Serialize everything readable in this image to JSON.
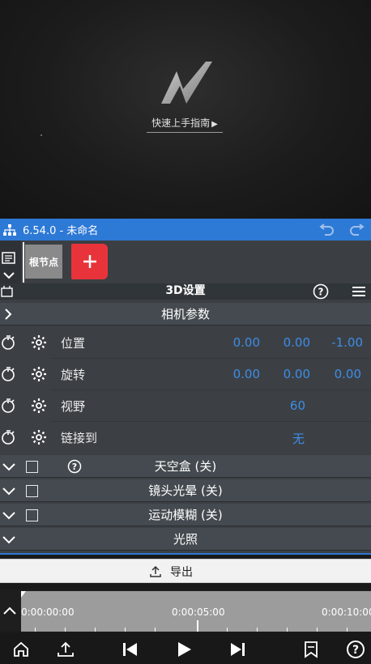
{
  "preview": {
    "guide_link": "快速上手指南",
    "guide_arrow": "▶"
  },
  "titlebar": {
    "title": "6.54.0 - 未命名"
  },
  "nodes": {
    "root_label": "根节点",
    "add_symbol": "+"
  },
  "panel": {
    "title": "3D设置",
    "camera_section": "相机参数",
    "params": [
      {
        "label": "位置",
        "values": [
          "0.00",
          "0.00",
          "-1.00"
        ]
      },
      {
        "label": "旋转",
        "values": [
          "0.00",
          "0.00",
          "0.00"
        ]
      },
      {
        "label": "视野",
        "values": [
          "60"
        ]
      },
      {
        "label": "链接到",
        "values": [
          "无"
        ]
      }
    ],
    "sections": [
      {
        "label": "天空盒 (关)"
      },
      {
        "label": "镜头光晕 (关)"
      },
      {
        "label": "运动模糊 (关)"
      },
      {
        "label": "光照"
      }
    ]
  },
  "export": {
    "label": "导出"
  },
  "timeline": {
    "ticks": [
      "0:00:00:00",
      "0:00:05:00",
      "0:00:10:00"
    ]
  },
  "colors": {
    "accent": "#2d79d6",
    "value_text": "#3d8de6",
    "add_button": "#e8333a"
  }
}
